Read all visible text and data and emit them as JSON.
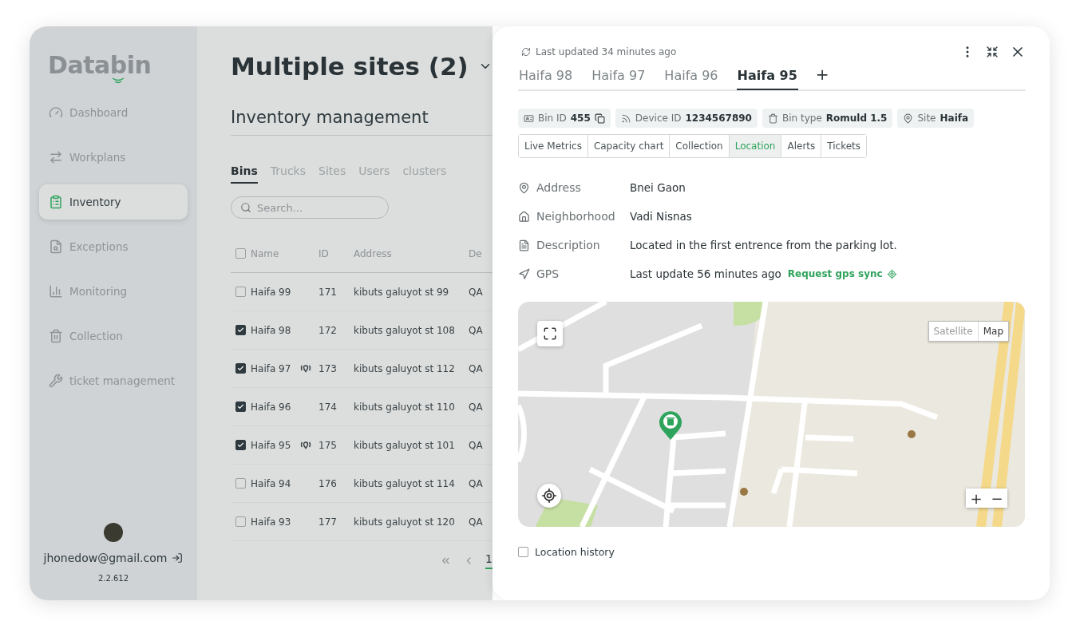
{
  "sidebar": {
    "logo": "Databin",
    "items": [
      {
        "label": "Dashboard",
        "selected": false
      },
      {
        "label": "Workplans",
        "selected": false
      },
      {
        "label": "Inventory",
        "selected": true
      },
      {
        "label": "Exceptions",
        "selected": false
      },
      {
        "label": "Monitoring",
        "selected": false
      },
      {
        "label": "Collection",
        "selected": false
      },
      {
        "label": "ticket management",
        "selected": false
      }
    ],
    "user": {
      "email": "jhonedow@gmail.com",
      "version": "2.2.612"
    }
  },
  "main": {
    "title": "Multiple sites (2)",
    "subtitle": "Inventory management",
    "tabs": [
      {
        "label": "Bins",
        "selected": true
      },
      {
        "label": "Trucks",
        "selected": false
      },
      {
        "label": "Sites",
        "selected": false
      },
      {
        "label": "Users",
        "selected": false
      },
      {
        "label": "clusters",
        "selected": false
      }
    ],
    "search": {
      "placeholder": "Search..."
    },
    "table": {
      "header_checked": false,
      "columns": [
        "Name",
        "ID",
        "Address",
        "De"
      ],
      "rows": [
        {
          "name": "Haifa 99",
          "pinned": false,
          "id": "171",
          "address": "kibuts galuyot st 99",
          "column_4": "QA",
          "checked": false
        },
        {
          "name": "Haifa 98",
          "pinned": false,
          "id": "172",
          "address": "kibuts galuyot st 108",
          "column_4": "QA",
          "checked": true
        },
        {
          "name": "Haifa 97",
          "pinned": true,
          "id": "173",
          "address": "kibuts galuyot st 112",
          "column_4": "QA",
          "checked": true
        },
        {
          "name": "Haifa 96",
          "pinned": false,
          "id": "174",
          "address": "kibuts galuyot st 110",
          "column_4": "QA",
          "checked": true
        },
        {
          "name": "Haifa 95",
          "pinned": true,
          "id": "175",
          "address": "kibuts galuyot st 101",
          "column_4": "QA",
          "checked": true
        },
        {
          "name": "Haifa 94",
          "pinned": false,
          "id": "176",
          "address": "kibuts galuyot st 114",
          "column_4": "QA",
          "checked": false
        },
        {
          "name": "Haifa 93",
          "pinned": false,
          "id": "177",
          "address": "kibuts galuyot st 120",
          "column_4": "QA",
          "checked": false
        }
      ]
    },
    "pagination": {
      "pages": [
        {
          "label": "1",
          "selected": true
        }
      ]
    }
  },
  "panel": {
    "last_updated": "Last updated 34 minutes ago",
    "tabs": [
      {
        "label": "Haifa 98",
        "selected": false
      },
      {
        "label": "Haifa 97",
        "selected": false
      },
      {
        "label": "Haifa 96",
        "selected": false
      },
      {
        "label": "Haifa 95",
        "selected": true
      }
    ],
    "add_tab": "+",
    "chips": [
      {
        "kind": "bin",
        "label": "Bin ID",
        "value": "455"
      },
      {
        "kind": "device",
        "label": "Device ID",
        "value": "1234567890"
      },
      {
        "kind": "type",
        "label": "Bin type",
        "value": "Romuld 1.5"
      },
      {
        "kind": "site",
        "label": "Site",
        "value": "Haifa"
      }
    ],
    "sections": [
      {
        "label": "Live Metrics",
        "selected": false
      },
      {
        "label": "Capacity chart",
        "selected": false
      },
      {
        "label": "Collection",
        "selected": false
      },
      {
        "label": "Location",
        "selected": true
      },
      {
        "label": "Alerts",
        "selected": false
      },
      {
        "label": "Tickets",
        "selected": false
      }
    ],
    "details": [
      {
        "kind": "address",
        "label": "Address",
        "value": "Bnei Gaon"
      },
      {
        "kind": "neighborhood",
        "label": "Neighborhood",
        "value": "Vadi Nisnas"
      },
      {
        "kind": "description",
        "label": "Description",
        "value": "Located in the first entrence from the parking lot."
      },
      {
        "kind": "gps",
        "label": "GPS",
        "value": "Last update 56 minutes ago",
        "action": "Request gps sync"
      }
    ],
    "map": {
      "types": [
        {
          "label": "Satellite",
          "selected": false
        },
        {
          "label": "Map",
          "selected": true
        }
      ],
      "zoom_in": "+",
      "zoom_out": "−"
    },
    "location_history": {
      "label": "Location history",
      "checked": false
    }
  }
}
